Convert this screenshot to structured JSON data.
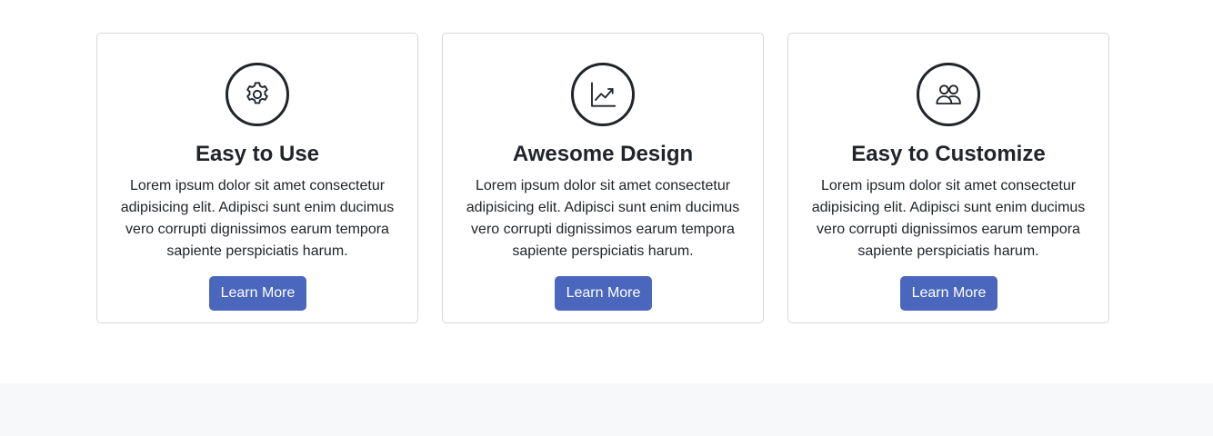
{
  "features": [
    {
      "icon": "gear-icon",
      "title": "Easy to Use",
      "text": "Lorem ipsum dolor sit amet consectetur adipisicing elit. Adipisci sunt enim ducimus vero corrupti dignissimos earum tempora sapiente perspiciatis harum.",
      "button_label": "Learn More"
    },
    {
      "icon": "chart-line-icon",
      "title": "Awesome Design",
      "text": "Lorem ipsum dolor sit amet consectetur adipisicing elit. Adipisci sunt enim ducimus vero corrupti dignissimos earum tempora sapiente perspiciatis harum.",
      "button_label": "Learn More"
    },
    {
      "icon": "people-icon",
      "title": "Easy to Customize",
      "text": "Lorem ipsum dolor sit amet consectetur adipisicing elit. Adipisci sunt enim ducimus vero corrupti dignissimos earum tempora sapiente perspiciatis harum.",
      "button_label": "Learn More"
    }
  ],
  "colors": {
    "button": "#4a66bd",
    "button_text": "#ffffff",
    "text": "#212529",
    "card_border": "#d6d8db",
    "footer_band": "#f7f8fa"
  }
}
